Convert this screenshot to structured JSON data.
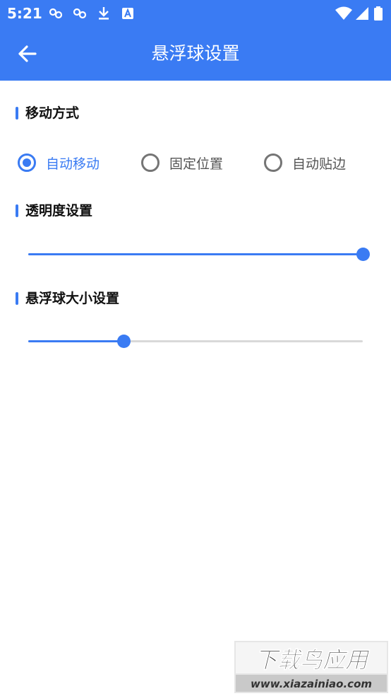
{
  "status_bar": {
    "time": "5:21",
    "left_icons": [
      "link-icon",
      "link-icon",
      "download-icon",
      "store-icon"
    ],
    "right_icons": [
      "wifi-icon",
      "signal-icon",
      "battery-icon"
    ]
  },
  "app_bar": {
    "back_icon": "arrow-left-icon",
    "title": "悬浮球设置"
  },
  "sections": {
    "move_mode": {
      "title": "移动方式",
      "options": [
        {
          "label": "自动移动",
          "checked": true
        },
        {
          "label": "固定位置",
          "checked": false
        },
        {
          "label": "自动贴边",
          "checked": false
        }
      ]
    },
    "transparency": {
      "title": "透明度设置",
      "value": 1.0
    },
    "ball_size": {
      "title": "悬浮球大小设置",
      "value": 0.285
    }
  },
  "watermark": {
    "main_text": "下载鸟应用",
    "url_text": "www.xiazainiao.com"
  },
  "colors": {
    "primary": "#3a7bf3",
    "radio_unchecked": "#757575",
    "track_inactive": "#d9d9d9"
  }
}
